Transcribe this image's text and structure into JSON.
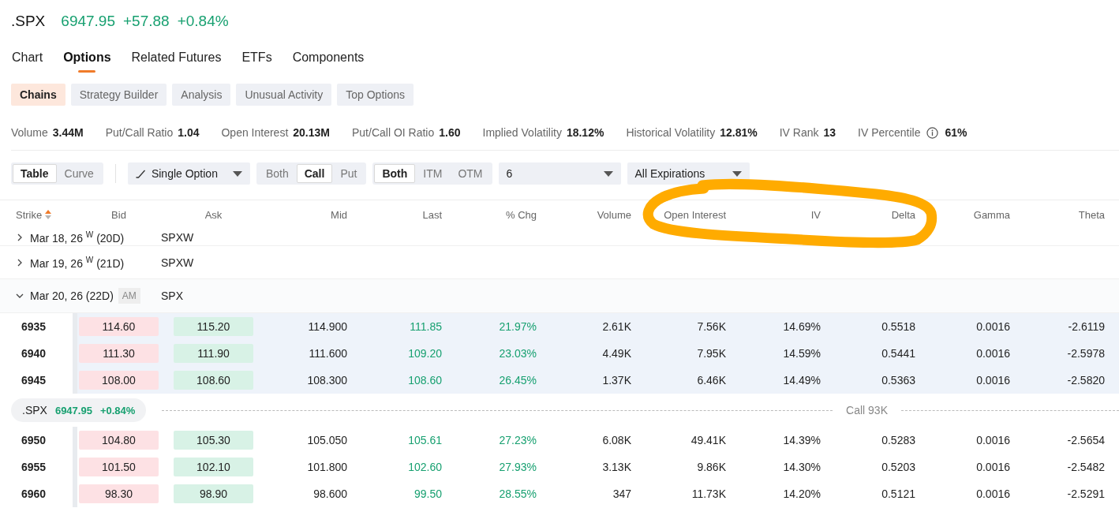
{
  "quote": {
    "symbol": ".SPX",
    "price": "6947.95",
    "change": "+57.88",
    "change_pct": "+0.84%",
    "positive": true
  },
  "tabs": [
    {
      "label": "Chart",
      "selected": false
    },
    {
      "label": "Options",
      "selected": true
    },
    {
      "label": "Related Futures",
      "selected": false
    },
    {
      "label": "ETFs",
      "selected": false
    },
    {
      "label": "Components",
      "selected": false
    }
  ],
  "subtabs": [
    {
      "label": "Chains",
      "selected": true
    },
    {
      "label": "Strategy Builder",
      "selected": false
    },
    {
      "label": "Analysis",
      "selected": false
    },
    {
      "label": "Unusual Activity",
      "selected": false
    },
    {
      "label": "Top Options",
      "selected": false
    }
  ],
  "stats": [
    {
      "label": "Volume",
      "value": "3.44M",
      "info": false
    },
    {
      "label": "Put/Call Ratio",
      "value": "1.04",
      "info": false
    },
    {
      "label": "Open Interest",
      "value": "20.13M",
      "info": false
    },
    {
      "label": "Put/Call OI Ratio",
      "value": "1.60",
      "info": false
    },
    {
      "label": "Implied Volatility",
      "value": "18.12%",
      "info": false
    },
    {
      "label": "Historical Volatility",
      "value": "12.81%",
      "info": false
    },
    {
      "label": "IV Rank",
      "value": "13",
      "info": false
    },
    {
      "label": "IV Percentile",
      "value": "61%",
      "info": true
    }
  ],
  "toolbar": {
    "view_toggle": [
      {
        "label": "Table",
        "selected": true
      },
      {
        "label": "Curve",
        "selected": false
      }
    ],
    "strategy_select": {
      "value": "Single Option"
    },
    "side_toggle": [
      {
        "label": "Both",
        "selected": false
      },
      {
        "label": "Call",
        "selected": true
      },
      {
        "label": "Put",
        "selected": false
      }
    ],
    "moneyness_toggle": [
      {
        "label": "Both",
        "selected": true
      },
      {
        "label": "ITM",
        "selected": false
      },
      {
        "label": "OTM",
        "selected": false
      }
    ],
    "strikes_select": {
      "value": "6"
    },
    "expiration_select": {
      "value": "All Expirations"
    }
  },
  "table": {
    "columns": [
      {
        "label": "Strike",
        "kind": "strike",
        "sorted_ascending": true
      },
      {
        "label": "Bid",
        "kind": "bid"
      },
      {
        "label": "Ask",
        "kind": "ask"
      },
      {
        "label": "Mid",
        "kind": "number"
      },
      {
        "label": "Last",
        "kind": "change"
      },
      {
        "label": "% Chg",
        "kind": "change"
      },
      {
        "label": "Volume",
        "kind": "number"
      },
      {
        "label": "Open Interest",
        "kind": "number"
      },
      {
        "label": "IV",
        "kind": "number"
      },
      {
        "label": "Delta",
        "kind": "number"
      },
      {
        "label": "Gamma",
        "kind": "number"
      },
      {
        "label": "Theta",
        "kind": "number"
      }
    ],
    "body": [
      {
        "kind": "expiry",
        "label": "Mar 18, 26 $^{W}$ (20D)",
        "root": "SPXW",
        "expanded": false
      },
      {
        "kind": "expiry",
        "label": "Mar 19, 26 $^{W}$ (21D)",
        "root": "SPXW",
        "expanded": false
      },
      {
        "kind": "expiry",
        "label": "Mar 20, 26 (22D)",
        "badge": "AM",
        "root": "SPX",
        "expanded": true
      },
      {
        "kind": "option",
        "itm": true,
        "positive": true,
        "cells": [
          "6935",
          "114.60",
          "115.20",
          "114.900",
          "111.85",
          "21.97%",
          "2.61K",
          "7.56K",
          "14.69%",
          "0.5518",
          "0.0016",
          "-2.6119"
        ]
      },
      {
        "kind": "option",
        "itm": true,
        "positive": true,
        "cells": [
          "6940",
          "111.30",
          "111.90",
          "111.600",
          "109.20",
          "23.03%",
          "4.49K",
          "7.95K",
          "14.59%",
          "0.5441",
          "0.0016",
          "-2.5978"
        ]
      },
      {
        "kind": "option",
        "itm": true,
        "positive": true,
        "cells": [
          "6945",
          "108.00",
          "108.60",
          "108.300",
          "108.60",
          "26.45%",
          "1.37K",
          "6.46K",
          "14.49%",
          "0.5363",
          "0.0016",
          "-2.5820"
        ]
      },
      {
        "kind": "underlying",
        "symbol": ".SPX",
        "price": "6947.95",
        "change_pct": "+0.84%",
        "positive": true,
        "label": "Call 93K"
      },
      {
        "kind": "option",
        "itm": false,
        "positive": true,
        "cells": [
          "6950",
          "104.80",
          "105.30",
          "105.050",
          "105.61",
          "27.23%",
          "6.08K",
          "49.41K",
          "14.39%",
          "0.5283",
          "0.0016",
          "-2.5654"
        ]
      },
      {
        "kind": "option",
        "itm": false,
        "positive": true,
        "cells": [
          "6955",
          "101.50",
          "102.10",
          "101.800",
          "102.60",
          "27.93%",
          "3.13K",
          "9.86K",
          "14.30%",
          "0.5203",
          "0.0016",
          "-2.5482"
        ]
      },
      {
        "kind": "option",
        "itm": false,
        "positive": true,
        "cells": [
          "6960",
          "98.30",
          "98.90",
          "98.600",
          "99.50",
          "28.55%",
          "347",
          "11.73K",
          "14.20%",
          "0.5121",
          "0.0016",
          "-2.5291"
        ]
      }
    ]
  },
  "annotations": [
    {
      "kind": "loop"
    }
  ]
}
